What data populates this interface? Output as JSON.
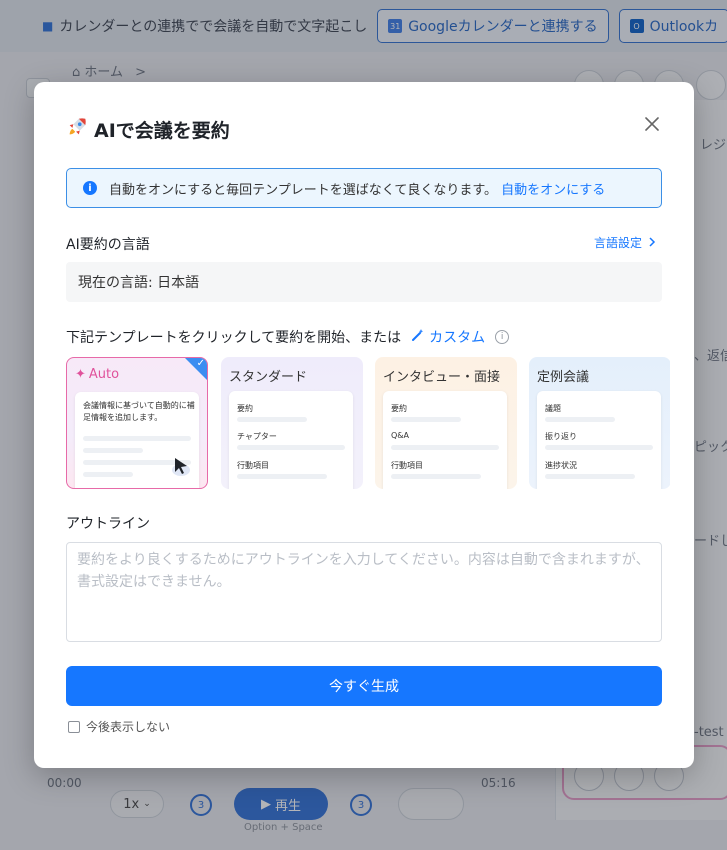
{
  "banner": {
    "text": "カレンダーとの連携でで会議を自動で文字起こし",
    "google_btn": "Googleカレンダーと連携する",
    "outlook_btn": "Outlookカ"
  },
  "background": {
    "breadcrumb_home": "ホーム",
    "breadcrumb_sep": ">",
    "side_texts": [
      "レジ",
      "、返信",
      "ピック",
      "ードし",
      "-test"
    ],
    "player": {
      "time_start": "00:00",
      "time_end": "05:16",
      "speed": "1x",
      "play_label": "再生",
      "skip_back": "3",
      "skip_forward": "3",
      "shortcut_hint": "Option + Space"
    }
  },
  "modal": {
    "title": "AIで会議を要約",
    "title_icon": "rocket-icon",
    "info": {
      "text": "自動をオンにすると毎回テンプレートを選ばなくて良くなります。",
      "link": "自動をオンにする"
    },
    "language": {
      "label": "AI要約の言語",
      "setting_link": "言語設定",
      "current": "現在の言語: 日本語"
    },
    "templates": {
      "prompt": "下記テンプレートをクリックして要約を開始、または",
      "custom_link": "カスタム",
      "cards": [
        {
          "title": "Auto",
          "description": "会議情報に基づいて自動的に補足情報を追加します。",
          "selected": true
        },
        {
          "title": "スタンダード",
          "items": [
            "要約",
            "チャプター",
            "行動項目"
          ]
        },
        {
          "title": "インタビュー・面接",
          "items": [
            "要約",
            "Q&A",
            "行動項目"
          ]
        },
        {
          "title": "定例会議",
          "items": [
            "議題",
            "振り返り",
            "進捗状況"
          ]
        }
      ]
    },
    "outline": {
      "label": "アウトライン",
      "placeholder": "要約をより良くするためにアウトラインを入力してください。内容は自動で含まれますが、書式設定はできません。"
    },
    "generate_button": "今すぐ生成",
    "dont_show_again": "今後表示しない"
  },
  "colors": {
    "primary": "#1677ff",
    "auto_accent": "#e0529b"
  }
}
